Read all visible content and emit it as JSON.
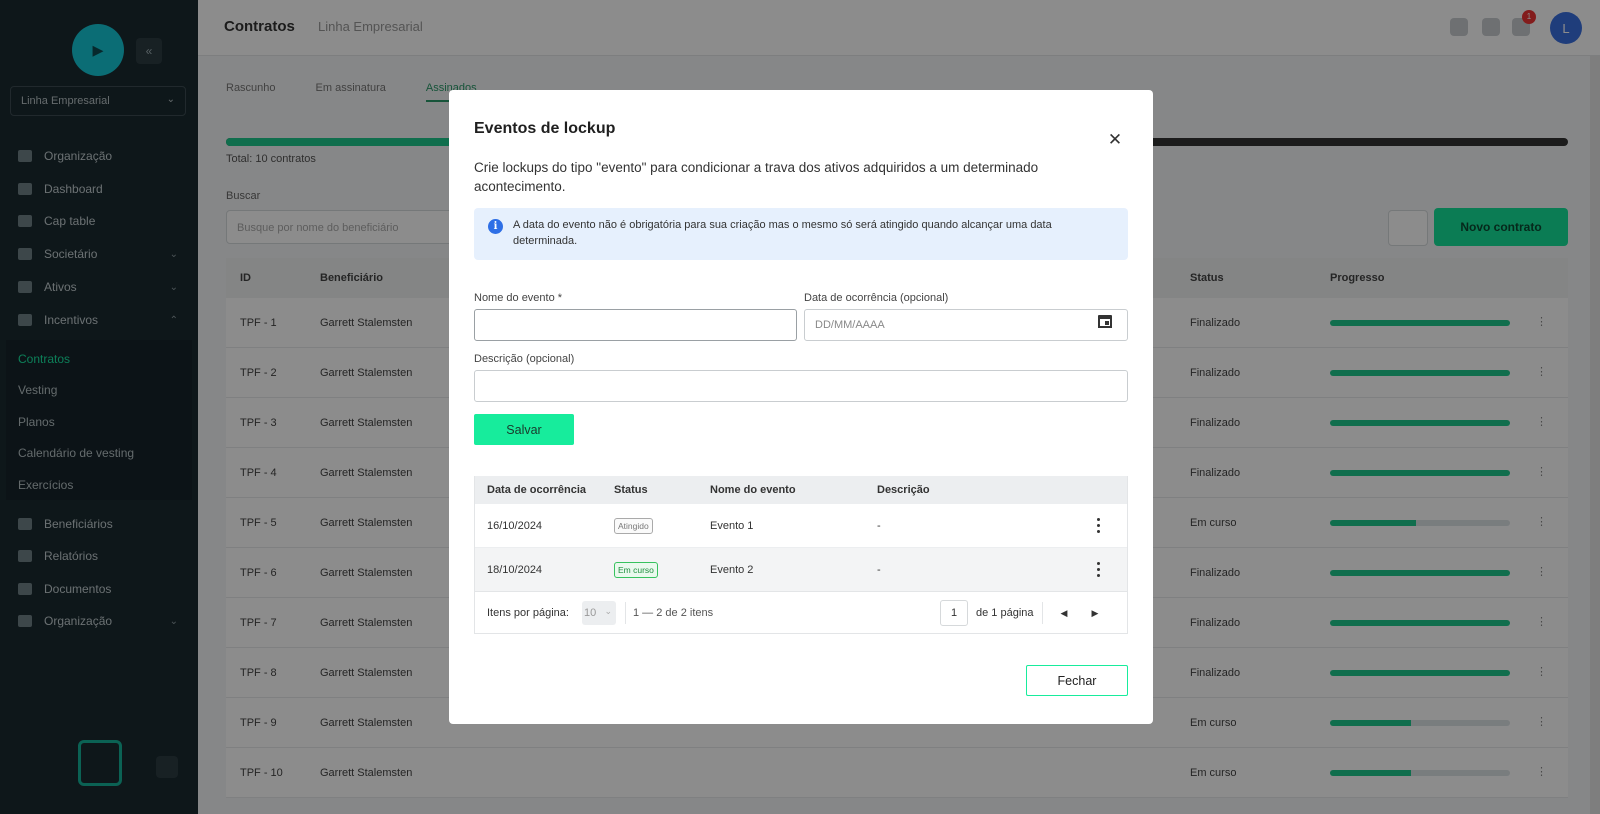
{
  "background": {
    "app_title": "Contratos",
    "app_subtitle": "Linha Empresarial",
    "user_initial": "L",
    "notification_count": "1",
    "sidebar": {
      "org_select": "Linha Empresarial",
      "items": [
        {
          "label": "Organização"
        },
        {
          "label": "Dashboard"
        },
        {
          "label": "Cap table"
        },
        {
          "label": "Societário"
        },
        {
          "label": "Ativos"
        },
        {
          "label": "Incentivos"
        }
      ],
      "subitems": [
        {
          "label": "Contratos"
        },
        {
          "label": "Vesting"
        },
        {
          "label": "Planos"
        },
        {
          "label": "Calendário de vesting"
        },
        {
          "label": "Exercícios"
        }
      ],
      "items_bottom": [
        {
          "label": "Beneficiários"
        },
        {
          "label": "Relatórios"
        },
        {
          "label": "Documentos"
        },
        {
          "label": "Organização"
        }
      ]
    },
    "tabs": [
      "Rascunho",
      "Em assinatura",
      "Assinados"
    ],
    "total_label": "Total: 10 contratos",
    "search_label": "Buscar",
    "search_placeholder": "Busque por nome do beneficiário",
    "new_button": "Novo contrato",
    "table_headers": [
      "ID",
      "Beneficiário",
      "Status",
      "Progresso"
    ],
    "rows": [
      {
        "id": "TPF - 1",
        "name": "Garrett Stalemsten",
        "status": "Finalizado",
        "progress": 1.0
      },
      {
        "id": "TPF - 2",
        "name": "Garrett Stalemsten",
        "status": "Finalizado",
        "progress": 1.0
      },
      {
        "id": "TPF - 3",
        "name": "Garrett Stalemsten",
        "status": "Finalizado",
        "progress": 1.0
      },
      {
        "id": "TPF - 4",
        "name": "Garrett Stalemsten",
        "status": "Finalizado",
        "progress": 1.0
      },
      {
        "id": "TPF - 5",
        "name": "Garrett Stalemsten",
        "status": "Em curso",
        "progress": 0.48
      },
      {
        "id": "TPF - 6",
        "name": "Garrett Stalemsten",
        "status": "Finalizado",
        "progress": 1.0
      },
      {
        "id": "TPF - 7",
        "name": "Garrett Stalemsten",
        "status": "Finalizado",
        "progress": 1.0
      },
      {
        "id": "TPF - 8",
        "name": "Garrett Stalemsten",
        "status": "Finalizado",
        "progress": 1.0
      },
      {
        "id": "TPF - 9",
        "name": "Garrett Stalemsten",
        "status": "Em curso",
        "progress": 0.45
      },
      {
        "id": "TPF - 10",
        "name": "Garrett Stalemsten",
        "status": "Em curso",
        "progress": 0.45
      }
    ]
  },
  "modal": {
    "title": "Eventos de lockup",
    "description": "Crie lockups do tipo \"evento\" para condicionar a trava dos ativos adquiridos a um determinado acontecimento.",
    "info": "A data do evento não é obrigatória para sua criação mas o mesmo só será atingido quando alcançar uma data determinada.",
    "form": {
      "event_name_label": "Nome do evento *",
      "event_name_value": "",
      "date_label": "Data de ocorrência (opcional)",
      "date_placeholder": "DD/MM/AAAA",
      "description_label": "Descrição (opcional)",
      "description_value": "",
      "save_label": "Salvar"
    },
    "table": {
      "headers": {
        "date": "Data de ocorrência",
        "status": "Status",
        "name": "Nome do evento",
        "description": "Descrição"
      },
      "rows": [
        {
          "date": "16/10/2024",
          "status": "Atingido",
          "name": "Evento 1",
          "description": "-"
        },
        {
          "date": "18/10/2024",
          "status": "Em curso",
          "name": "Evento 2",
          "description": "-"
        }
      ],
      "pagination": {
        "per_page_label": "Itens por página:",
        "per_page_value": "10",
        "range": "1 — 2 de 2 itens",
        "current_page": "1",
        "of_pages": "de 1 página"
      }
    },
    "close_label": "Fechar"
  },
  "colors": {
    "accent": "#17ec9c",
    "info_bg": "#e6f0fd",
    "info_icon": "#2e6fe6",
    "sidebar_bg": "#1b2a30"
  }
}
